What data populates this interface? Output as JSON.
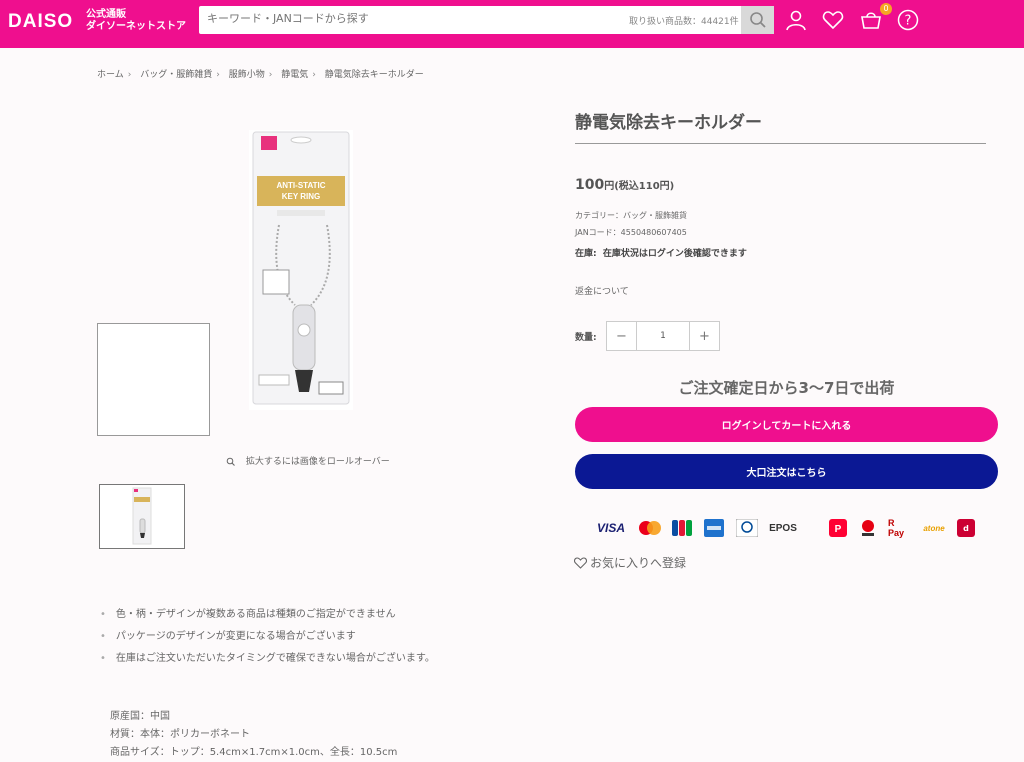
{
  "header": {
    "logo": "DAISO",
    "logo_sub1": "公式通販",
    "logo_sub2": "ダイソーネットストア",
    "search_placeholder": "キーワード・JANコードから探す",
    "item_count": "取り扱い商品数：44421件",
    "cart_count": "0",
    "brand_color": "#ef0f8e"
  },
  "breadcrumb": [
    "ホーム",
    "バッグ・服飾雑貨",
    "服飾小物",
    "静電気",
    "静電気除去キーホルダー"
  ],
  "gallery": {
    "zoom_hint": "拡大するには画像をロールオーバー",
    "package_label1": "ANTI-STATIC",
    "package_label2": "KEY RING"
  },
  "product": {
    "title": "静電気除去キーホルダー",
    "price": "100",
    "price_unit": "円(税込110円)",
    "category": "カテゴリー：バッグ・服飾雑貨",
    "jan": "JANコード：4550480607405",
    "stock_label": "在庫:",
    "stock_value": "在庫状況はログイン後確認できます",
    "refund": "返金について",
    "qty_label": "数量:",
    "qty_value": "1",
    "qty_minus": "−",
    "qty_plus": "+",
    "shipping": "ご注文確定日から3〜7日で出荷",
    "cart_button": "ログインしてカートに入れる",
    "bulk_button": "大口注文はこちら",
    "favorite": "お気に入りへ登録",
    "bulk_color": "#0b1894"
  },
  "payments": [
    "VISA",
    "Mastercard",
    "JCB",
    "AMERICAN EXPRESS",
    "Diners Club",
    "EPOS",
    "PayPay",
    "Pay",
    "R Pay",
    "atone",
    "d払い"
  ],
  "notes": [
    "色・柄・デザインが複数ある商品は種類のご指定ができません",
    "パッケージのデザインが変更になる場合がございます",
    "在庫はご注文いただいたタイミングで確保できない場合がございます。"
  ],
  "specs": {
    "origin": "原産国：中国",
    "material": "材質：本体：ポリカーボネート",
    "size": "商品サイズ：トップ：5.4cm×1.7cm×1.0cm、全長：10.5cm"
  }
}
